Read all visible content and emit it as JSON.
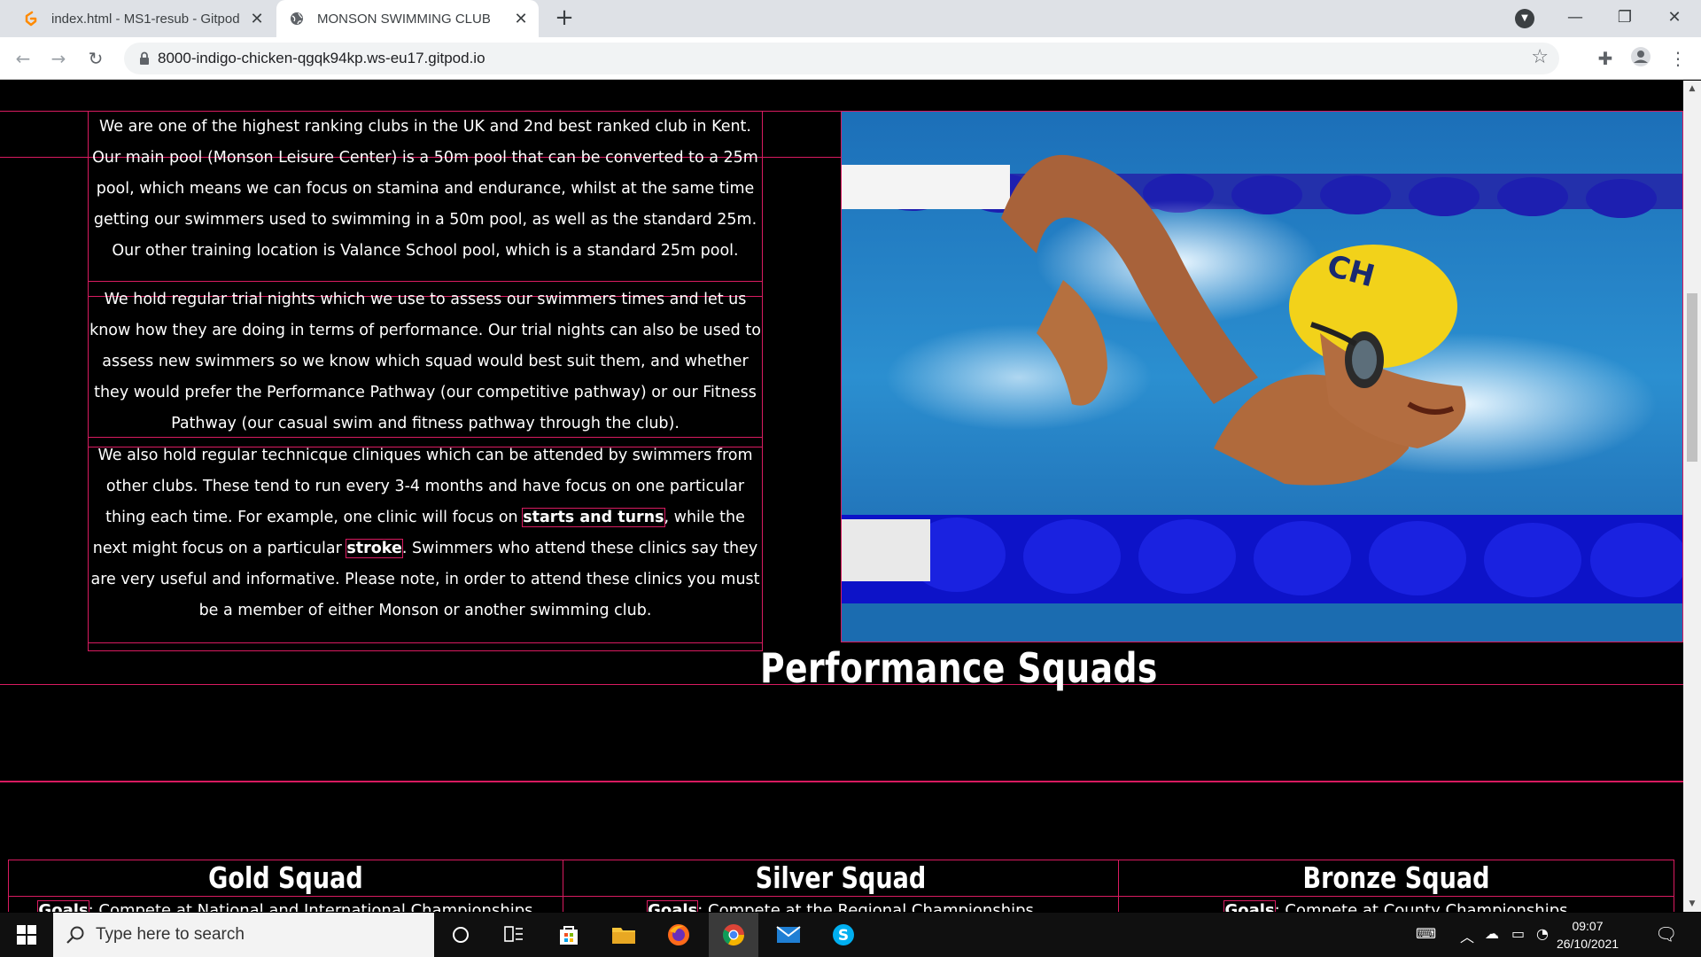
{
  "browser": {
    "tabs": [
      {
        "title": "index.html - MS1-resub - Gitpod",
        "active": false
      },
      {
        "title": "MONSON SWIMMING CLUB",
        "active": true
      }
    ],
    "new_tab": "+",
    "url": "8000-indigo-chicken-qgqk94kp.ws-eu17.gitpod.io"
  },
  "content": {
    "para1": "We are one of the highest ranking clubs in the UK and 2nd best ranked club in Kent. Our main pool (Monson Leisure Center) is a 50m pool that can be converted to a 25m pool, which means we can focus on stamina and endurance, whilst at the same time getting our swimmers used to swimming in a 50m pool, as well as the standard 25m. Our other training location is Valance School pool, which is a standard 25m pool.",
    "para2": "We hold regular trial nights which we use to assess our swimmers times and let us know how they are doing in terms of performance. Our trial nights can also be used to assess new swimmers so we know which squad would best suit them, and whether they would prefer the Performance Pathway (our competitive pathway) or our Fitness Pathway (our casual swim and fitness pathway through the club).",
    "para3_a": "We also hold regular technicque cliniques which can be attended by swimmers from other clubs. These tend to run every 3-4 months and have focus on one particular thing each time. For example, one clinic will focus on ",
    "para3_b": "starts and turns",
    "para3_c": ", while the next might focus on a particular ",
    "para3_d": "stroke",
    "para3_e": ". Swimmers who attend these clinics say they are very useful and informative. Please note, in order to attend these clinics you must be a member of either Monson or another swimming club.",
    "section_title": "Performance Squads",
    "squads": [
      {
        "name": "Gold Squad",
        "goal_label": "Goals",
        "goal_text": ": Compete at National and International Championships"
      },
      {
        "name": "Silver Squad",
        "goal_label": "Goals",
        "goal_text": ": Compete at the Regional Championships"
      },
      {
        "name": "Bronze Squad",
        "goal_label": "Goals",
        "goal_text": ": Compete at County Championships"
      }
    ]
  },
  "taskbar": {
    "search_placeholder": "Type here to search",
    "time": "09:07",
    "date": "26/10/2021"
  }
}
